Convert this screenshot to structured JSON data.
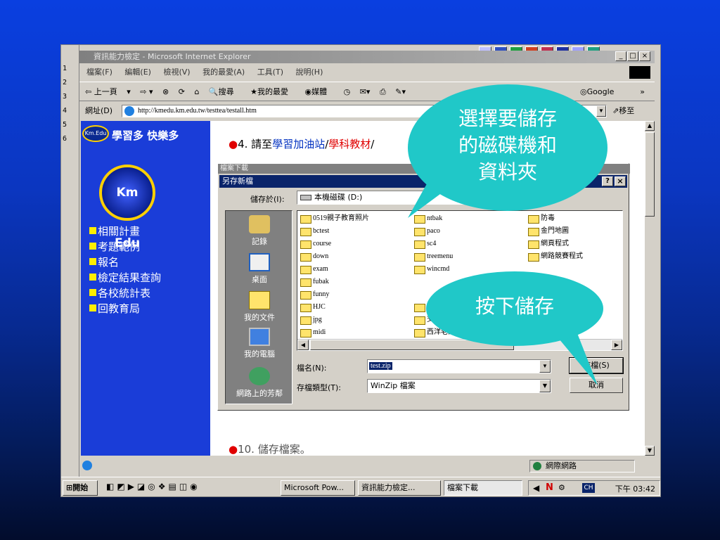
{
  "ie": {
    "title": "資訊能力檢定 - Microsoft Internet Explorer",
    "menu": [
      "檔案(F)",
      "編輯(E)",
      "檢視(V)",
      "我的最愛(A)",
      "工具(T)",
      "說明(H)"
    ],
    "toolbar": [
      "上一頁",
      "搜尋",
      "我的最愛",
      "媒體",
      "Google"
    ],
    "address_label": "網址(D)",
    "address": "http://kmedu.km.edu.tw/testtea/testall.htm",
    "go_label": "移至",
    "status_zone": "網際網路"
  },
  "ppt_left": [
    "1",
    "2",
    "3",
    "4",
    "5",
    "6"
  ],
  "left_frame": {
    "banner": "學習多 快樂多",
    "logo_small": "Km.Edu",
    "logo": "Km Edu",
    "items": [
      "相關計畫",
      "考題範例",
      "報名",
      "檢定結果查詢",
      "各校統計表",
      "回教育局"
    ]
  },
  "right_frame": {
    "step4_prefix": "4. 請至",
    "step4_link1": "學習加油站",
    "step4_sep": "/",
    "step4_link2": "學科教材",
    "step4_sep2": "/",
    "step10": "10. 儲存檔案。"
  },
  "dialog": {
    "outer_title": "檔案下載",
    "title": "另存新檔",
    "save_in_label": "儲存於(I):",
    "save_in_value": "本機磁碟 (D:)",
    "places": [
      "記錄",
      "桌面",
      "我的文件",
      "我的電腦",
      "網路上的芳鄰"
    ],
    "files": [
      [
        "0519親子教育照片",
        "ntbak",
        "防毒"
      ],
      [
        "bctest",
        "paco",
        "金門地圖"
      ],
      [
        "course",
        "sc4",
        "網頁程式"
      ],
      [
        "down",
        "treemenu",
        "網路競賽程式"
      ],
      [
        "exam",
        "wincmd",
        ""
      ],
      [
        "fubak",
        "",
        ""
      ],
      [
        "funny",
        "",
        ""
      ],
      [
        "HJC",
        "丹青",
        ""
      ],
      [
        "jpg",
        "交通二",
        ""
      ],
      [
        "midi",
        "西洋老式情歌",
        ""
      ]
    ],
    "filename_label": "檔名(N):",
    "filename_value": "test.zip",
    "filetype_label": "存檔類型(T):",
    "filetype_value": "WinZip 檔案",
    "save_button": "存檔(S)",
    "cancel_button": "取消",
    "help_button": "?",
    "close_button": "×"
  },
  "bubbles": {
    "top": "選擇要儲存的磁碟機和資料夾",
    "bottom": "按下儲存"
  },
  "taskbar": {
    "start": "開始",
    "tasks": [
      "Microsoft Pow...",
      "資訊能力檢定...",
      "檔案下載"
    ],
    "clock": "下午 03:42"
  },
  "colors": {
    "accent": "#0a246a",
    "bubble": "#20c8c8",
    "left_frame_bg": "#1a3dd8",
    "menu_bullet": "#ffee00"
  }
}
